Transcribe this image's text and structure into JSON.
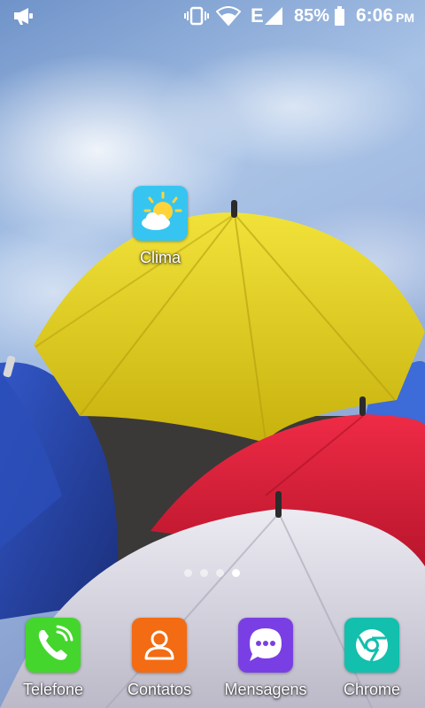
{
  "status_bar": {
    "battery_percent": "85%",
    "time": "6:06",
    "ampm": "PM",
    "network_type": "E",
    "icons": [
      "notification-megaphone-icon",
      "vibrate-icon",
      "wifi-icon",
      "signal-icon",
      "battery-icon"
    ]
  },
  "home": {
    "apps": [
      {
        "label": "Clima",
        "icon": "weather-icon",
        "color": "#36C5F0"
      }
    ]
  },
  "page_indicator": {
    "count": 4,
    "active_index": 3
  },
  "dock": {
    "apps": [
      {
        "label": "Telefone",
        "icon": "phone-icon",
        "color": "#44D62C"
      },
      {
        "label": "Contatos",
        "icon": "contacts-icon",
        "color": "#F36B12"
      },
      {
        "label": "Mensagens",
        "icon": "messages-icon",
        "color": "#7A3FE4"
      },
      {
        "label": "Chrome",
        "icon": "chrome-icon",
        "color": "#13BFAD"
      }
    ]
  }
}
